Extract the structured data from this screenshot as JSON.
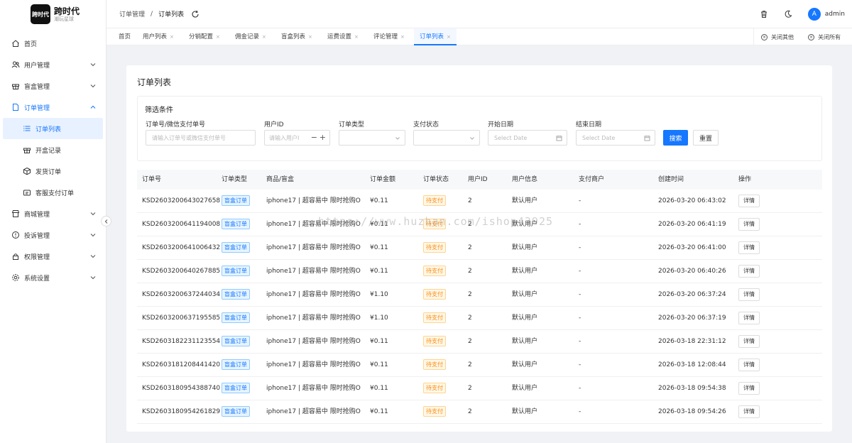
{
  "logo": {
    "box_text": "跨时代",
    "title": "跨时代",
    "subtitle": "潮玩星球"
  },
  "sidebar": {
    "items": [
      {
        "label": "首页",
        "icon": "home-icon"
      },
      {
        "label": "用户管理",
        "icon": "users-icon"
      },
      {
        "label": "盲盒管理",
        "icon": "gift-icon"
      },
      {
        "label": "订单管理",
        "icon": "document-icon"
      },
      {
        "label": "商城管理",
        "icon": "store-icon"
      },
      {
        "label": "投诉管理",
        "icon": "alert-icon"
      },
      {
        "label": "权限管理",
        "icon": "lock-icon"
      },
      {
        "label": "系统设置",
        "icon": "gear-icon"
      }
    ],
    "submenu": [
      {
        "label": "订单列表",
        "icon": "list-icon"
      },
      {
        "label": "开盒记录",
        "icon": "box-icon"
      },
      {
        "label": "发货订单",
        "icon": "package-icon"
      },
      {
        "label": "客服支付订单",
        "icon": "service-icon"
      }
    ]
  },
  "header": {
    "breadcrumb": [
      "订单管理",
      "/",
      "订单列表"
    ],
    "user": {
      "avatar_letter": "A",
      "name": "admin"
    }
  },
  "tabs": {
    "items": [
      "首页",
      "用户列表",
      "分销配置",
      "佣金记录",
      "盲盒列表",
      "运费设置",
      "评论管理",
      "订单列表"
    ],
    "close_mark": "×",
    "close_others": "关闭其他",
    "close_all": "关闭所有"
  },
  "card": {
    "title": "订单列表"
  },
  "filter": {
    "title": "筛选条件",
    "order_no": {
      "label": "订单号/微信支付单号",
      "placeholder": "请输入订单号或微信支付单号"
    },
    "user_id": {
      "label": "用户ID",
      "placeholder": "请输入用户I",
      "minus": "−",
      "plus": "+"
    },
    "order_type": {
      "label": "订单类型"
    },
    "pay_status": {
      "label": "支付状态"
    },
    "start_date": {
      "label": "开始日期",
      "placeholder": "Select Date"
    },
    "end_date": {
      "label": "结束日期",
      "placeholder": "Select Date"
    },
    "search_btn": "搜索",
    "reset_btn": "重置"
  },
  "table": {
    "headers": [
      "订单号",
      "订单类型",
      "商品/盲盒",
      "订单金额",
      "订单状态",
      "用户ID",
      "用户信息",
      "支付商户",
      "创建时间",
      "操作"
    ],
    "rows": [
      {
        "order_no": "KSD2603200643027658",
        "type": "盲盒订单",
        "product": "iphone17 | 超容易中 限时抢购O",
        "amount": "¥0.11",
        "status": "待支付",
        "user_id": "2",
        "user_info": "默认用户",
        "merchant": "-",
        "created": "2026-03-20 06:43:02",
        "action": "详情"
      },
      {
        "order_no": "KSD2603200641194008",
        "type": "盲盒订单",
        "product": "iphone17 | 超容易中 限时抢购O",
        "amount": "¥0.11",
        "status": "待支付",
        "user_id": "2",
        "user_info": "默认用户",
        "merchant": "-",
        "created": "2026-03-20 06:41:19",
        "action": "详情"
      },
      {
        "order_no": "KSD2603200641006432",
        "type": "盲盒订单",
        "product": "iphone17 | 超容易中 限时抢购O",
        "amount": "¥0.11",
        "status": "待支付",
        "user_id": "2",
        "user_info": "默认用户",
        "merchant": "-",
        "created": "2026-03-20 06:41:00",
        "action": "详情"
      },
      {
        "order_no": "KSD2603200640267885",
        "type": "盲盒订单",
        "product": "iphone17 | 超容易中 限时抢购O",
        "amount": "¥0.11",
        "status": "待支付",
        "user_id": "2",
        "user_info": "默认用户",
        "merchant": "-",
        "created": "2026-03-20 06:40:26",
        "action": "详情"
      },
      {
        "order_no": "KSD2603200637244034",
        "type": "盲盒订单",
        "product": "iphone17 | 超容易中 限时抢购O",
        "amount": "¥1.10",
        "status": "待支付",
        "user_id": "2",
        "user_info": "默认用户",
        "merchant": "-",
        "created": "2026-03-20 06:37:24",
        "action": "详情"
      },
      {
        "order_no": "KSD2603200637195585",
        "type": "盲盒订单",
        "product": "iphone17 | 超容易中 限时抢购O",
        "amount": "¥1.10",
        "status": "待支付",
        "user_id": "2",
        "user_info": "默认用户",
        "merchant": "-",
        "created": "2026-03-20 06:37:19",
        "action": "详情"
      },
      {
        "order_no": "KSD2603182231123554",
        "type": "盲盒订单",
        "product": "iphone17 | 超容易中 限时抢购O",
        "amount": "¥0.11",
        "status": "待支付",
        "user_id": "2",
        "user_info": "默认用户",
        "merchant": "-",
        "created": "2026-03-18 22:31:12",
        "action": "详情"
      },
      {
        "order_no": "KSD2603181208441420",
        "type": "盲盒订单",
        "product": "iphone17 | 超容易中 限时抢购O",
        "amount": "¥0.11",
        "status": "待支付",
        "user_id": "2",
        "user_info": "默认用户",
        "merchant": "-",
        "created": "2026-03-18 12:08:44",
        "action": "详情"
      },
      {
        "order_no": "KSD2603180954388740",
        "type": "盲盒订单",
        "product": "iphone17 | 超容易中 限时抢购O",
        "amount": "¥0.11",
        "status": "待支付",
        "user_id": "2",
        "user_info": "默认用户",
        "merchant": "-",
        "created": "2026-03-18 09:54:38",
        "action": "详情"
      },
      {
        "order_no": "KSD2603180954261829",
        "type": "盲盒订单",
        "product": "iphone17 | 超容易中 限时抢购O",
        "amount": "¥0.11",
        "status": "待支付",
        "user_id": "2",
        "user_info": "默认用户",
        "merchant": "-",
        "created": "2026-03-18 09:54:26",
        "action": "详情"
      }
    ]
  },
  "watermark": "https://www.huzhan.com/ishop43925"
}
